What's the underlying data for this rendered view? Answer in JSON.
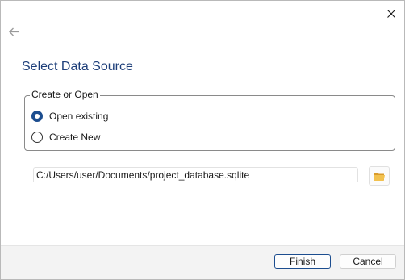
{
  "dialog": {
    "title": "Select Data Source",
    "close_icon": "close-icon",
    "back_icon": "back-arrow-icon"
  },
  "group": {
    "legend": "Create or Open",
    "options": [
      {
        "label": "Open existing",
        "checked": true
      },
      {
        "label": "Create New",
        "checked": false
      }
    ]
  },
  "path": {
    "value": "C:/Users/user/Documents/project_database.sqlite",
    "browse_icon": "folder-icon"
  },
  "footer": {
    "finish_label": "Finish",
    "cancel_label": "Cancel"
  },
  "colors": {
    "accent": "#1c4d8f",
    "title": "#1e3f7a",
    "footer_bg": "#f3f3f3",
    "folder": "#e8b04a"
  }
}
